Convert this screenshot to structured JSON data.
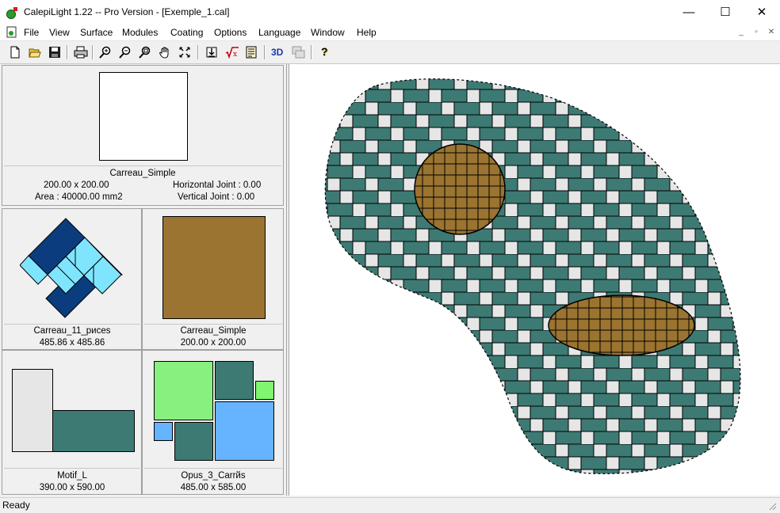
{
  "window": {
    "title": "CalepiLight 1.22 -- Pro Version - [Exemple_1.cal]",
    "controls": {
      "minimize": "—",
      "maximize": "☐",
      "close": "✕"
    }
  },
  "menu": {
    "items": [
      "File",
      "View",
      "Surface",
      "Modules",
      "Coating",
      "Options",
      "Language",
      "Window",
      "Help"
    ]
  },
  "toolbar": {
    "buttons": [
      "new-icon",
      "open-icon",
      "save-icon",
      "print-icon",
      "zoom-in-icon",
      "zoom-out-icon",
      "zoom-window-icon",
      "pan-hand-icon",
      "zoom-fit-icon",
      "import-icon",
      "formula-icon",
      "report-icon",
      "3d-icon",
      "layers-icon",
      "help-icon"
    ],
    "label_3d": "3D",
    "help_label": "?"
  },
  "panel": {
    "top": {
      "name": "Carreau_Simple",
      "size": "200.00 x 200.00",
      "area": "Area : 40000.00 mm2",
      "hjoint": "Horizontal Joint : 0.00",
      "vjoint": "Vertical Joint : 0.00"
    },
    "tiles": [
      {
        "name": "Carreau_11_pиces",
        "size": "485.86 x 485.86"
      },
      {
        "name": "Carreau_Simple",
        "size": "200.00 x 200.00"
      },
      {
        "name": "Motif_L",
        "size": "390.00 x 590.00"
      },
      {
        "name": "Opus_3_Carrйs",
        "size": "485.00 x 585.00"
      }
    ]
  },
  "colors": {
    "teal": "#3d7a73",
    "light_gray": "#e6e6e6",
    "brown": "#9a7430",
    "navy": "#0b3d7e",
    "cyan": "#7fe5ff",
    "light_green": "#88f07f",
    "light_blue": "#66b3ff",
    "bright_green": "#7ef66e"
  },
  "status": {
    "text": "Ready"
  }
}
